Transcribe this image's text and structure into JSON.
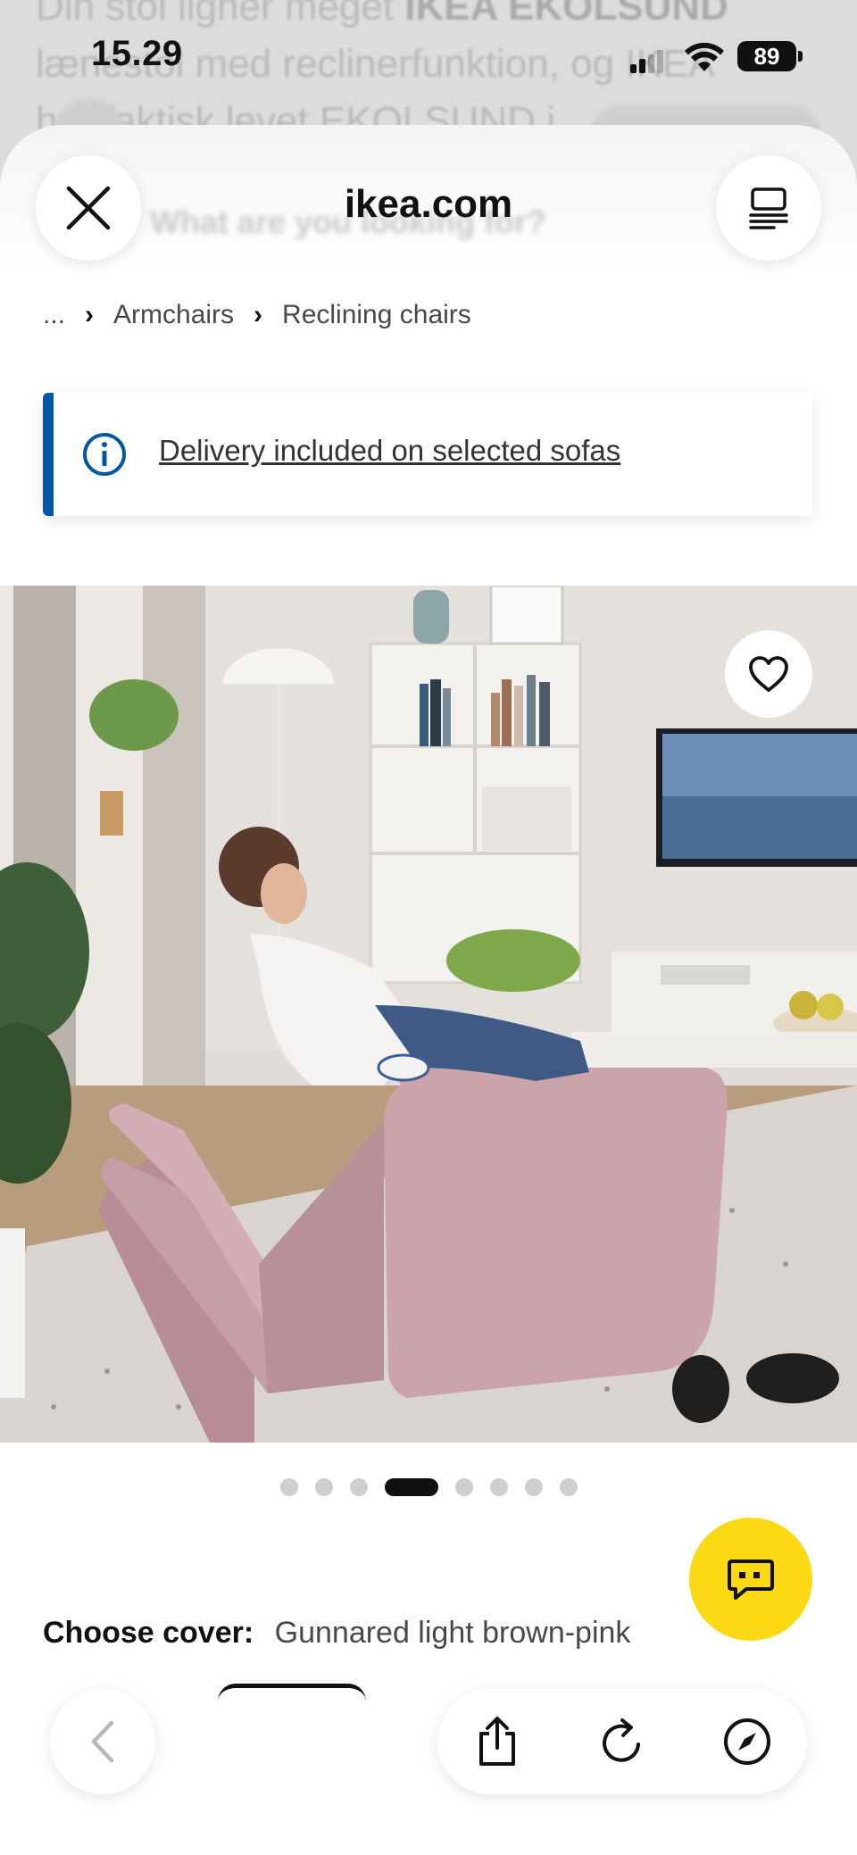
{
  "background_page": {
    "text_line1_normal": "Din stol ligner meget ",
    "text_line1_bold": "IKEA EKOLSUND",
    "text_line2": "lænestol med reclinerfunktion, og IKEA",
    "text_line3": "har faktisk levet EKOLSUND i",
    "search_placeholder": "What are you looking for?"
  },
  "status_bar": {
    "time": "15.29",
    "battery": "89"
  },
  "header": {
    "site": "ikea.com"
  },
  "breadcrumb": {
    "ellipsis": "...",
    "items": [
      "Armchairs",
      "Reclining chairs"
    ]
  },
  "banner": {
    "link_text": "Delivery included on selected sofas"
  },
  "carousel": {
    "dot_count": 8,
    "active_index": 3
  },
  "product": {
    "cover_label": "Choose cover:",
    "cover_value": "Gunnared light brown-pink"
  },
  "colors": {
    "ikea_blue": "#0058a3",
    "ikea_yellow": "#fbd914",
    "chair_pink": "#c9a0a8"
  },
  "icons": {
    "close": "close-icon",
    "reader": "reader-mode-icon",
    "info": "info-icon",
    "favorite": "heart-icon",
    "chat": "chat-icon",
    "back": "chevron-left-icon",
    "share": "share-icon",
    "reload": "reload-icon",
    "compass": "compass-icon"
  }
}
